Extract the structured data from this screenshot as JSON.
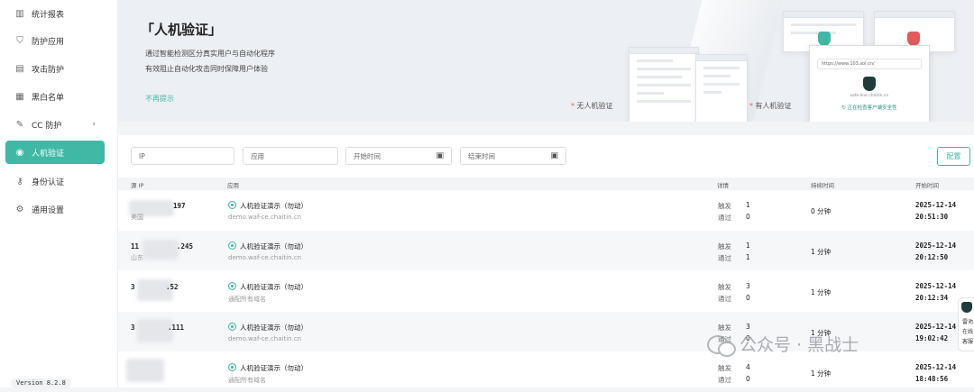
{
  "sidebar": {
    "items": [
      {
        "label": "统计报表",
        "icon": "bar-chart-icon"
      },
      {
        "label": "防护应用",
        "icon": "shield-icon"
      },
      {
        "label": "攻击防护",
        "icon": "attack-log-icon"
      },
      {
        "label": "黑白名单",
        "icon": "list-icon"
      },
      {
        "label": "CC 防护",
        "icon": "wrench-icon",
        "has_children": true
      },
      {
        "label": "人机验证",
        "icon": "robot-icon",
        "active": true
      },
      {
        "label": "身份认证",
        "icon": "key-icon"
      },
      {
        "label": "通用设置",
        "icon": "gear-icon"
      }
    ],
    "version": "Version 8.2.8"
  },
  "banner": {
    "title": "「人机验证」",
    "desc_line1": "通过智能检测区分真实用户与自动化程序",
    "desc_line2": "有效阻止自动化攻击同时保障用户体验",
    "dismiss": "不再提示",
    "caption_without": "无人机验证",
    "caption_with": "有人机验证",
    "caption_marker": "*",
    "verify_url": "https://www.103.sol.cn/",
    "verify_domain": "safe-line.chaitin.cn",
    "verify_status": "正在检查客户端安全性"
  },
  "filters": {
    "ip_placeholder": "IP",
    "app_placeholder": "应用",
    "start_placeholder": "开始时间",
    "end_placeholder": "结束时间",
    "reset_label": "配置"
  },
  "table": {
    "headers": {
      "source_ip": "源 IP",
      "app": "应用",
      "detail": "详情",
      "duration": "持续时间",
      "start_time": "开始时间"
    },
    "trigger_label": "触发",
    "pass_label": "通过",
    "rows": [
      {
        "ip": "197",
        "region": "美国",
        "app_name": "人机验证演示（勿动）",
        "app_domain": "demo.waf-ce.chaitin.cn",
        "triggered": "1",
        "passed": "0",
        "duration": "0 分钟",
        "date": "2025-12-14",
        "time": "20:51:30"
      },
      {
        "ip": "11",
        "ip_tail": ".245",
        "region": "山东",
        "app_name": "人机验证演示（勿动）",
        "app_domain": "demo.waf-ce.chaitin.cn",
        "triggered": "1",
        "passed": "1",
        "duration": "1 分钟",
        "date": "2025-12-14",
        "time": "20:12:50"
      },
      {
        "ip": "3",
        "ip_tail": ".52",
        "region": "",
        "app_name": "人机验证演示（勿动）",
        "app_domain": "通配所有域名",
        "triggered": "3",
        "passed": "0",
        "duration": "1 分钟",
        "date": "2025-12-14",
        "time": "20:12:34"
      },
      {
        "ip": "3",
        "ip_tail": ".111",
        "region": "",
        "app_name": "人机验证演示（勿动）",
        "app_domain": "demo.waf-ce.chaitin.cn",
        "triggered": "3",
        "passed": "0",
        "duration": "1 分钟",
        "date": "2025-12-14",
        "time": "19:02:42"
      },
      {
        "ip": "",
        "region": "",
        "app_name": "人机验证演示（勿动）",
        "app_domain": "通配所有域名",
        "triggered": "4",
        "passed": "0",
        "duration": "1 分钟",
        "date": "2025-12-14",
        "time": "18:48:56"
      }
    ]
  },
  "float_widget": {
    "line1": "雷池",
    "line2": "在线",
    "line3": "客服"
  },
  "watermark": {
    "text": "公众号 · 黑战士"
  },
  "colors": {
    "accent": "#3fb9a5",
    "sidebar_bg": "#ffffff",
    "banner_bg": "#eceff3",
    "danger": "#e25b5b"
  }
}
